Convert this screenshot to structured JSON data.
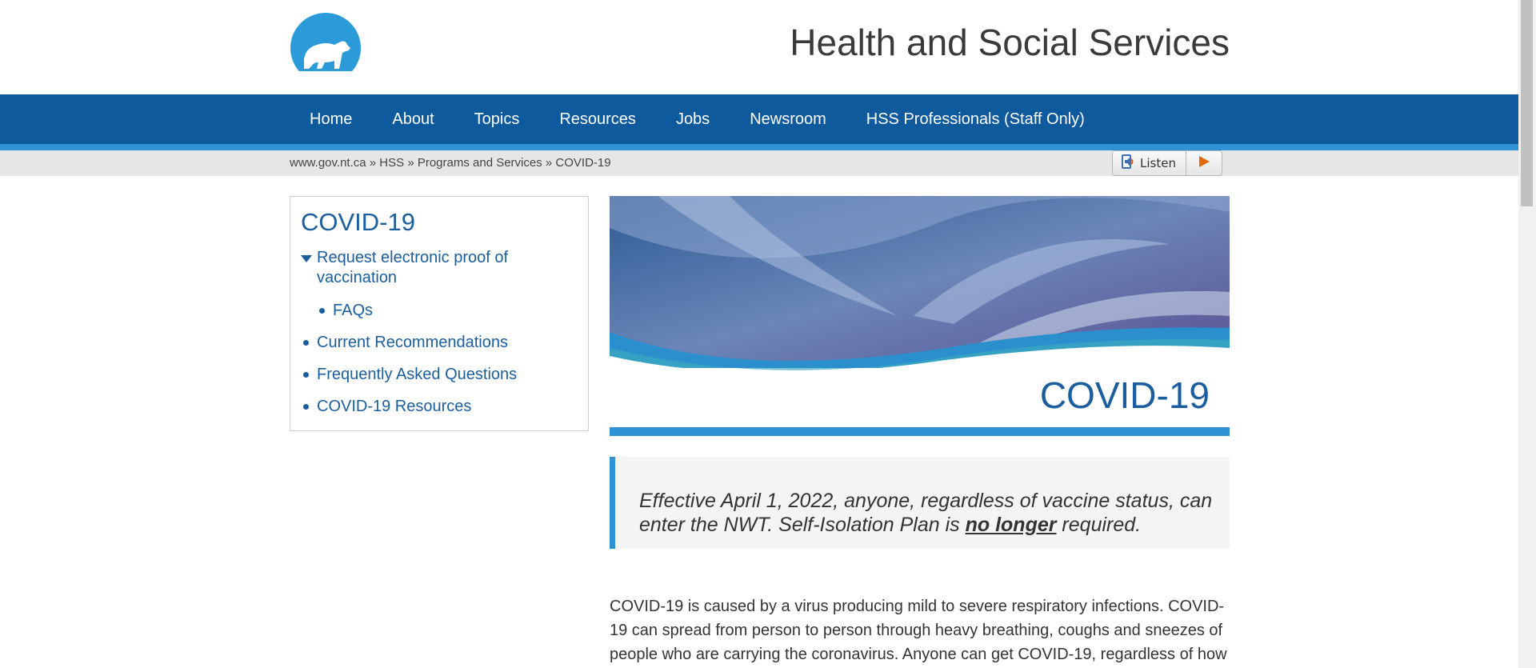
{
  "header": {
    "site_title": "Health and Social Services"
  },
  "nav": {
    "items": [
      "Home",
      "About",
      "Topics",
      "Resources",
      "Jobs",
      "Newsroom",
      "HSS Professionals (Staff Only)"
    ]
  },
  "breadcrumb": {
    "items": [
      "www.gov.nt.ca",
      "HSS",
      "Programs and Services",
      "COVID-19"
    ],
    "sep": "»"
  },
  "listen": {
    "label": "Listen"
  },
  "sidebar": {
    "title": "COVID-19",
    "items": [
      "Request electronic proof of vaccination",
      "FAQs",
      "Current Recommendations",
      "Frequently Asked Questions",
      "COVID-19 Resources"
    ]
  },
  "banner": {
    "title": "COVID-19"
  },
  "notice": {
    "before": "Effective April 1, 2022, anyone, regardless of vaccine status, can enter the NWT. Self-Isolation Plan is ",
    "emphasis": "no longer",
    "after": " required."
  },
  "body": {
    "paragraph": "COVID-19 is caused by a virus producing mild to severe respiratory infections. COVID-19 can spread from person to person through heavy breathing, coughs and sneezes of people who are carrying the coronavirus. Anyone can get COVID-19, regardless of how"
  },
  "colors": {
    "nav": "#0e5a9c",
    "accent": "#2f93d3",
    "link": "#1b5e9e"
  },
  "icons": {
    "logo": "polar-bear-logo",
    "listen": "speaker-icon",
    "play": "play-icon"
  }
}
